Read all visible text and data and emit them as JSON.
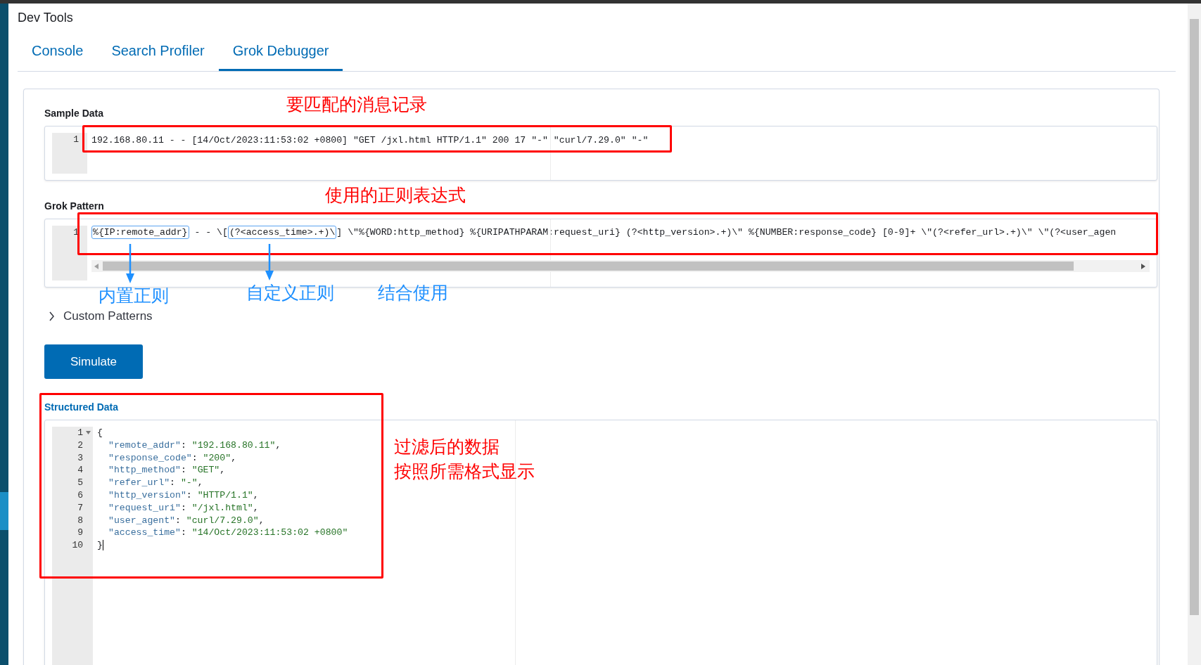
{
  "app_title": "Dev Tools",
  "tabs": [
    {
      "label": "Console",
      "selected": false
    },
    {
      "label": "Search Profiler",
      "selected": false
    },
    {
      "label": "Grok Debugger",
      "selected": true
    }
  ],
  "sample_data": {
    "label": "Sample Data",
    "lines": [
      {
        "number": "1",
        "text": "192.168.80.11 - - [14/Oct/2023:11:53:02 +0800] \"GET /jxl.html HTTP/1.1\" 200 17 \"-\" \"curl/7.29.0\" \"-\""
      }
    ]
  },
  "grok_pattern": {
    "label": "Grok Pattern",
    "line_number": "1",
    "segments": [
      {
        "text": "%{IP:remote_addr}",
        "highlighted": true
      },
      {
        "text": " - - \\[",
        "highlighted": false
      },
      {
        "text": "(?<access_time>.+)\\",
        "highlighted": true
      },
      {
        "text": "] \\\"%{WORD:http_method} %{URIPATHPARAM:request_uri} (?<http_version>.+)\\\" %{NUMBER:response_code} [0-9]+ \\\"(?<refer_url>.+)\\\" \\\"(?<user_agen",
        "highlighted": false
      }
    ]
  },
  "custom_patterns": {
    "label": "Custom Patterns",
    "expanded": false
  },
  "simulate_button": "Simulate",
  "structured_data": {
    "label": "Structured Data",
    "lines": [
      {
        "number": "1",
        "kind": "brace",
        "text": "{",
        "foldable": true
      },
      {
        "number": "2",
        "kind": "pair",
        "key": "\"remote_addr\"",
        "colon": ": ",
        "value": "\"192.168.80.11\"",
        "comma": ","
      },
      {
        "number": "3",
        "kind": "pair",
        "key": "\"response_code\"",
        "colon": ": ",
        "value": "\"200\"",
        "comma": ","
      },
      {
        "number": "4",
        "kind": "pair",
        "key": "\"http_method\"",
        "colon": ": ",
        "value": "\"GET\"",
        "comma": ","
      },
      {
        "number": "5",
        "kind": "pair",
        "key": "\"refer_url\"",
        "colon": ": ",
        "value": "\"-\"",
        "comma": ","
      },
      {
        "number": "6",
        "kind": "pair",
        "key": "\"http_version\"",
        "colon": ": ",
        "value": "\"HTTP/1.1\"",
        "comma": ","
      },
      {
        "number": "7",
        "kind": "pair",
        "key": "\"request_uri\"",
        "colon": ": ",
        "value": "\"/jxl.html\"",
        "comma": ","
      },
      {
        "number": "8",
        "kind": "pair",
        "key": "\"user_agent\"",
        "colon": ": ",
        "value": "\"curl/7.29.0\"",
        "comma": ","
      },
      {
        "number": "9",
        "kind": "pair",
        "key": "\"access_time\"",
        "colon": ": ",
        "value": "\"14/Oct/2023:11:53:02 +0800\""
      },
      {
        "number": "10",
        "kind": "brace",
        "text": "}",
        "foldable": false,
        "cursor": true
      }
    ]
  },
  "annotations": [
    {
      "text": "要匹配的消息记录",
      "color": "#ff0000"
    },
    {
      "text": "使用的正则表达式",
      "color": "#ff0000"
    },
    {
      "text": "内置正则",
      "color": "#1e90ff"
    },
    {
      "text": "自定义正则",
      "color": "#1e90ff"
    },
    {
      "text": "结合使用",
      "color": "#1e90ff"
    },
    {
      "text": "过滤后的数据",
      "color": "#ff0000"
    },
    {
      "text": "按照所需格式显示",
      "color": "#ff0000"
    }
  ]
}
